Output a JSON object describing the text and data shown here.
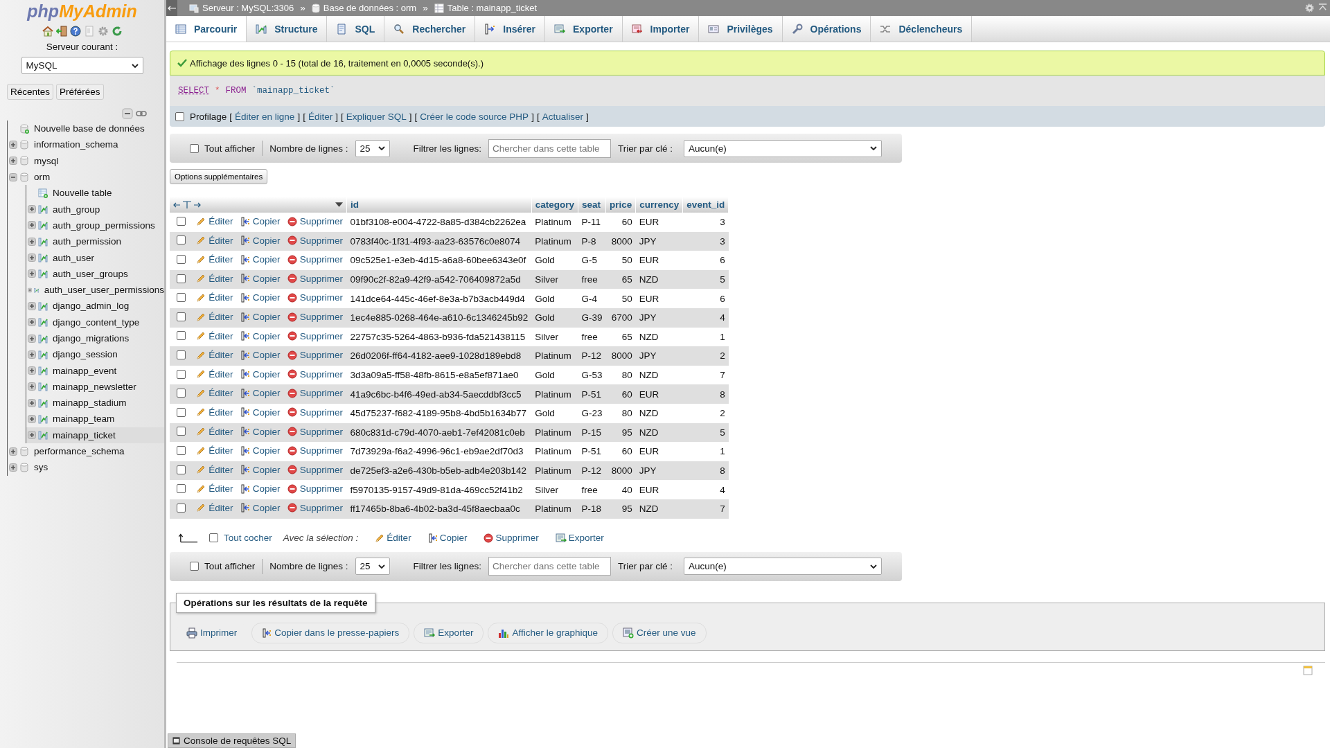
{
  "sidebar": {
    "logo": {
      "php": "php",
      "name": "MyAdmin"
    },
    "server_label": "Serveur courant :",
    "server_select": "MySQL",
    "buttons": [
      "Récentes",
      "Préférées"
    ],
    "tree": [
      {
        "label": "Nouvelle base de données",
        "kind": "new-db",
        "selected": false
      },
      {
        "label": "information_schema",
        "kind": "db",
        "expanded": false,
        "selected": false
      },
      {
        "label": "mysql",
        "kind": "db",
        "expanded": false,
        "selected": false
      },
      {
        "label": "orm",
        "kind": "db",
        "expanded": true,
        "selected": false,
        "children": [
          {
            "label": "Nouvelle table",
            "kind": "new-table",
            "selected": false
          },
          {
            "label": "auth_group",
            "kind": "table",
            "expanded": false,
            "selected": false
          },
          {
            "label": "auth_group_permissions",
            "kind": "table",
            "expanded": false,
            "selected": false
          },
          {
            "label": "auth_permission",
            "kind": "table",
            "expanded": false,
            "selected": false
          },
          {
            "label": "auth_user",
            "kind": "table",
            "expanded": false,
            "selected": false
          },
          {
            "label": "auth_user_groups",
            "kind": "table",
            "expanded": false,
            "selected": false
          },
          {
            "label": "auth_user_user_permissions",
            "kind": "table",
            "expanded": false,
            "selected": false
          },
          {
            "label": "django_admin_log",
            "kind": "table",
            "expanded": false,
            "selected": false
          },
          {
            "label": "django_content_type",
            "kind": "table",
            "expanded": false,
            "selected": false
          },
          {
            "label": "django_migrations",
            "kind": "table",
            "expanded": false,
            "selected": false
          },
          {
            "label": "django_session",
            "kind": "table",
            "expanded": false,
            "selected": false
          },
          {
            "label": "mainapp_event",
            "kind": "table",
            "expanded": false,
            "selected": false
          },
          {
            "label": "mainapp_newsletter",
            "kind": "table",
            "expanded": false,
            "selected": false
          },
          {
            "label": "mainapp_stadium",
            "kind": "table",
            "expanded": false,
            "selected": false
          },
          {
            "label": "mainapp_team",
            "kind": "table",
            "expanded": false,
            "selected": false
          },
          {
            "label": "mainapp_ticket",
            "kind": "table",
            "expanded": false,
            "selected": true
          }
        ]
      },
      {
        "label": "performance_schema",
        "kind": "db",
        "expanded": false,
        "selected": false
      },
      {
        "label": "sys",
        "kind": "db",
        "expanded": false,
        "selected": false
      }
    ]
  },
  "breadcrumb": [
    {
      "label": "Serveur : MySQL:3306",
      "kind": "server"
    },
    {
      "label": "Base de données : orm",
      "kind": "database"
    },
    {
      "label": "Table : mainapp_ticket",
      "kind": "table"
    }
  ],
  "breadcrumb_separator": "»",
  "tabs": [
    {
      "label": "Parcourir",
      "kind": "browse",
      "selected": true
    },
    {
      "label": "Structure",
      "kind": "structure",
      "selected": false
    },
    {
      "label": "SQL",
      "kind": "sql",
      "selected": false
    },
    {
      "label": "Rechercher",
      "kind": "search",
      "selected": false
    },
    {
      "label": "Insérer",
      "kind": "insert",
      "selected": false
    },
    {
      "label": "Exporter",
      "kind": "export",
      "selected": false
    },
    {
      "label": "Importer",
      "kind": "import",
      "selected": false
    },
    {
      "label": "Privilèges",
      "kind": "privileges",
      "selected": false
    },
    {
      "label": "Opérations",
      "kind": "operations",
      "selected": false
    },
    {
      "label": "Déclencheurs",
      "kind": "triggers",
      "selected": false
    }
  ],
  "message": "Affichage des lignes 0 - 15 (total de 16, traitement en 0,0005 seconde(s).)",
  "sql": [
    {
      "text": "SELECT",
      "kind": "keyword"
    },
    {
      "text": "*",
      "kind": "operator"
    },
    {
      "text": "FROM",
      "kind": "keyword"
    },
    {
      "text": "`mainapp_ticket`",
      "kind": "identifier"
    }
  ],
  "profiling": {
    "label": "Profilage",
    "checked": false,
    "open": "[",
    "close": "]",
    "links": [
      "Éditer en ligne",
      "Éditer",
      "Expliquer SQL",
      "Créer le code source PHP",
      "Actualiser"
    ]
  },
  "nav_top": {
    "show_all": "Tout afficher",
    "show_all_checked": false,
    "rows_label": "Nombre de lignes :",
    "rows_value": "25",
    "filter_label": "Filtrer les lignes:",
    "filter_placeholder": "Chercher dans cette table",
    "sort_label": "Trier par clé :",
    "sort_value": "Aucun(e)"
  },
  "extra_options": "Options supplémentaires",
  "table": {
    "columns": [
      "id",
      "category",
      "seat",
      "price",
      "currency",
      "event_id"
    ],
    "rows": [
      {
        "checked": false,
        "edit": "Éditer",
        "copy": "Copier",
        "delete": "Supprimer",
        "cells": [
          "01bf3108-e004-4722-8a85-d384cb2262ea",
          "Platinum",
          "P-11",
          "60",
          "EUR",
          "3"
        ]
      },
      {
        "checked": false,
        "edit": "Éditer",
        "copy": "Copier",
        "delete": "Supprimer",
        "cells": [
          "0783f40c-1f31-4f93-aa23-63576c0e8074",
          "Platinum",
          "P-8",
          "8000",
          "JPY",
          "3"
        ]
      },
      {
        "checked": false,
        "edit": "Éditer",
        "copy": "Copier",
        "delete": "Supprimer",
        "cells": [
          "09c525e1-e3eb-4d15-a6a8-60bee6343e0f",
          "Gold",
          "G-5",
          "50",
          "EUR",
          "6"
        ]
      },
      {
        "checked": false,
        "edit": "Éditer",
        "copy": "Copier",
        "delete": "Supprimer",
        "cells": [
          "09f90c2f-82a9-42f9-a542-706409872a5d",
          "Silver",
          "free",
          "65",
          "NZD",
          "5"
        ]
      },
      {
        "checked": false,
        "edit": "Éditer",
        "copy": "Copier",
        "delete": "Supprimer",
        "cells": [
          "141dce64-445c-46ef-8e3a-b7b3acb449d4",
          "Gold",
          "G-4",
          "50",
          "EUR",
          "6"
        ]
      },
      {
        "checked": false,
        "edit": "Éditer",
        "copy": "Copier",
        "delete": "Supprimer",
        "cells": [
          "1ec4e885-0268-464e-a610-6c1346245b92",
          "Gold",
          "G-39",
          "6700",
          "JPY",
          "4"
        ]
      },
      {
        "checked": false,
        "edit": "Éditer",
        "copy": "Copier",
        "delete": "Supprimer",
        "cells": [
          "22757c35-5264-4863-b936-fda521438115",
          "Silver",
          "free",
          "65",
          "NZD",
          "1"
        ]
      },
      {
        "checked": false,
        "edit": "Éditer",
        "copy": "Copier",
        "delete": "Supprimer",
        "cells": [
          "26d0206f-ff64-4182-aee9-1028d189ebd8",
          "Platinum",
          "P-12",
          "8000",
          "JPY",
          "2"
        ]
      },
      {
        "checked": false,
        "edit": "Éditer",
        "copy": "Copier",
        "delete": "Supprimer",
        "cells": [
          "3d3a09a5-ff58-48fb-8615-e8a5ef871ae0",
          "Gold",
          "G-53",
          "80",
          "NZD",
          "7"
        ]
      },
      {
        "checked": false,
        "edit": "Éditer",
        "copy": "Copier",
        "delete": "Supprimer",
        "cells": [
          "41a9c6bc-b4f6-49ed-ab34-5aecddbf3cc5",
          "Platinum",
          "P-51",
          "60",
          "EUR",
          "8"
        ]
      },
      {
        "checked": false,
        "edit": "Éditer",
        "copy": "Copier",
        "delete": "Supprimer",
        "cells": [
          "45d75237-f682-4189-95b8-4bd5b1634b77",
          "Gold",
          "G-23",
          "80",
          "NZD",
          "2"
        ]
      },
      {
        "checked": false,
        "edit": "Éditer",
        "copy": "Copier",
        "delete": "Supprimer",
        "cells": [
          "680c831d-c79d-4070-aeb1-7ef42081c0eb",
          "Platinum",
          "P-15",
          "95",
          "NZD",
          "5"
        ]
      },
      {
        "checked": false,
        "edit": "Éditer",
        "copy": "Copier",
        "delete": "Supprimer",
        "cells": [
          "7d73929a-f6a2-4996-96c1-eb9ae2df70d3",
          "Platinum",
          "P-51",
          "60",
          "EUR",
          "1"
        ]
      },
      {
        "checked": false,
        "edit": "Éditer",
        "copy": "Copier",
        "delete": "Supprimer",
        "cells": [
          "de725ef3-a2e6-430b-b5eb-adb4e203b142",
          "Platinum",
          "P-12",
          "8000",
          "JPY",
          "8"
        ]
      },
      {
        "checked": false,
        "edit": "Éditer",
        "copy": "Copier",
        "delete": "Supprimer",
        "cells": [
          "f5970135-9157-49d9-81da-469cc52f41b2",
          "Silver",
          "free",
          "40",
          "EUR",
          "4"
        ]
      },
      {
        "checked": false,
        "edit": "Éditer",
        "copy": "Copier",
        "delete": "Supprimer",
        "cells": [
          "ff17465b-8ba6-4b02-ba3d-45f8aecbaa0c",
          "Platinum",
          "P-18",
          "95",
          "NZD",
          "7"
        ]
      }
    ]
  },
  "selection": {
    "check_all": "Tout cocher",
    "checked": false,
    "label": "Avec la sélection :",
    "actions": [
      {
        "label": "Éditer",
        "kind": "edit"
      },
      {
        "label": "Copier",
        "kind": "copy"
      },
      {
        "label": "Supprimer",
        "kind": "delete"
      },
      {
        "label": "Exporter",
        "kind": "export"
      }
    ]
  },
  "nav_bottom": {
    "show_all": "Tout afficher",
    "show_all_checked": false,
    "rows_label": "Nombre de lignes :",
    "rows_value": "25",
    "filter_label": "Filtrer les lignes:",
    "filter_placeholder": "Chercher dans cette table",
    "sort_label": "Trier par clé :",
    "sort_value": "Aucun(e)"
  },
  "operations": {
    "title": "Opérations sur les résultats de la requête",
    "buttons": [
      {
        "label": "Imprimer",
        "kind": "print"
      },
      {
        "label": "Copier dans le presse-papiers",
        "kind": "copy"
      },
      {
        "label": "Exporter",
        "kind": "export"
      },
      {
        "label": "Afficher le graphique",
        "kind": "chart"
      },
      {
        "label": "Créer une vue",
        "kind": "view"
      }
    ]
  },
  "console": "Console de requêtes SQL"
}
